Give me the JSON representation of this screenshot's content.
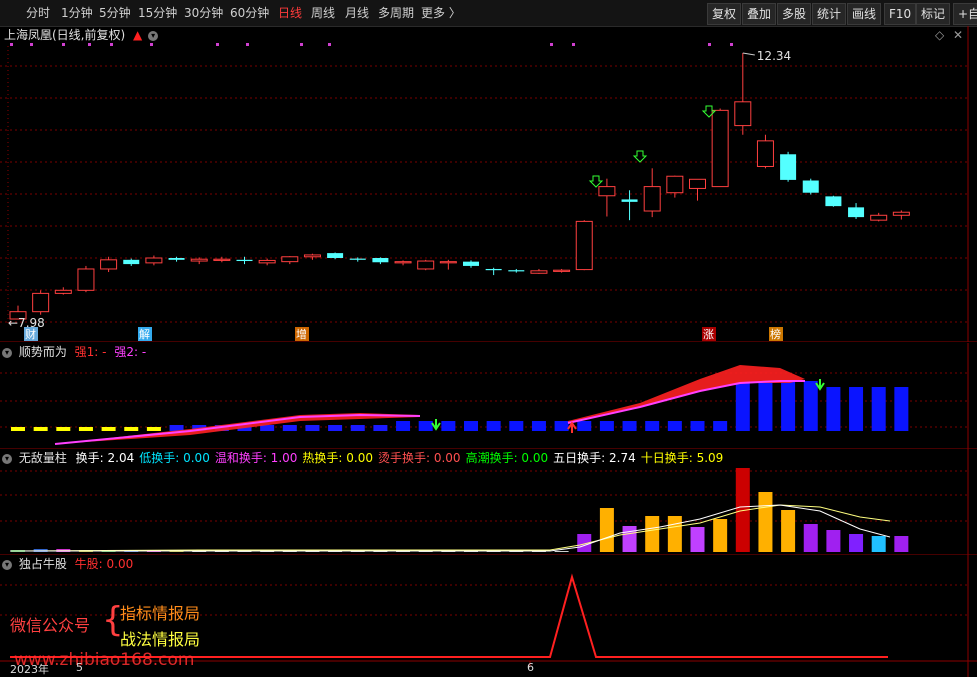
{
  "toolbar": {
    "periods": [
      "分时",
      "1分钟",
      "5分钟",
      "15分钟",
      "30分钟",
      "60分钟",
      "日线",
      "周线",
      "月线",
      "多周期",
      "更多 〉"
    ],
    "active_period": "日线",
    "buttons": [
      "复权",
      "叠加",
      "多股",
      "统计",
      "画线",
      "F10",
      "标记",
      "+自选"
    ]
  },
  "main_panel": {
    "title": "上海凤凰(日线,前复权)",
    "high_label": "12.34",
    "low_label": "7.98",
    "event_tags": [
      "财",
      "解",
      "增",
      "涨",
      "榜"
    ]
  },
  "indicator1": {
    "name": "顺势而为",
    "strong1_label": "强1: -",
    "strong2_label": "强2: -"
  },
  "indicator2": {
    "name": "无敌量柱",
    "items": [
      {
        "label": "换手: 2.04",
        "color": "#ffffff"
      },
      {
        "label": "低换手: 0.00",
        "color": "#00e5ff"
      },
      {
        "label": "温和换手: 1.00",
        "color": "#ff40ff"
      },
      {
        "label": "热换手: 0.00",
        "color": "#ffff00"
      },
      {
        "label": "烫手换手: 0.00",
        "color": "#ff5050"
      },
      {
        "label": "高潮换手: 0.00",
        "color": "#00ff00"
      },
      {
        "label": "五日换手: 2.74",
        "color": "#ffffff"
      },
      {
        "label": "十日换手: 5.09",
        "color": "#ffff00"
      }
    ]
  },
  "indicator3": {
    "name": "独占牛股",
    "value_label": "牛股: 0.00"
  },
  "watermark": {
    "line_prefix": "微信公众号",
    "brace": "{",
    "line1": "指标情报局",
    "line2": "战法情报局",
    "url": "www.zhibiao168.com"
  },
  "date_axis": {
    "year": "2023年",
    "mark1": "5",
    "mark2": "6"
  },
  "colors": {
    "up": "#ff4040",
    "down": "#54ffff",
    "grid": "#8b0000",
    "active": "#ff3b3b"
  },
  "candles": [
    {
      "o": 7.98,
      "h": 8.2,
      "l": 7.98,
      "c": 8.1
    },
    {
      "o": 8.1,
      "h": 8.45,
      "l": 8.05,
      "c": 8.4
    },
    {
      "o": 8.4,
      "h": 8.5,
      "l": 8.38,
      "c": 8.45
    },
    {
      "o": 8.45,
      "h": 8.85,
      "l": 8.42,
      "c": 8.8
    },
    {
      "o": 8.8,
      "h": 9.0,
      "l": 8.75,
      "c": 8.95
    },
    {
      "o": 8.95,
      "h": 8.97,
      "l": 8.85,
      "c": 8.88
    },
    {
      "o": 8.9,
      "h": 9.02,
      "l": 8.86,
      "c": 8.98
    },
    {
      "o": 8.98,
      "h": 9.0,
      "l": 8.92,
      "c": 8.95
    },
    {
      "o": 8.93,
      "h": 8.99,
      "l": 8.88,
      "c": 8.96
    },
    {
      "o": 8.94,
      "h": 9.0,
      "l": 8.91,
      "c": 8.96
    },
    {
      "o": 8.95,
      "h": 9.0,
      "l": 8.88,
      "c": 8.94
    },
    {
      "o": 8.9,
      "h": 8.97,
      "l": 8.86,
      "c": 8.94
    },
    {
      "o": 8.92,
      "h": 9.01,
      "l": 8.88,
      "c": 9.0
    },
    {
      "o": 9.0,
      "h": 9.05,
      "l": 8.95,
      "c": 9.03
    },
    {
      "o": 9.06,
      "h": 9.07,
      "l": 8.96,
      "c": 8.98
    },
    {
      "o": 8.97,
      "h": 8.99,
      "l": 8.92,
      "c": 8.96
    },
    {
      "o": 8.98,
      "h": 8.99,
      "l": 8.88,
      "c": 8.91
    },
    {
      "o": 8.9,
      "h": 8.94,
      "l": 8.86,
      "c": 8.92
    },
    {
      "o": 8.8,
      "h": 8.95,
      "l": 8.78,
      "c": 8.93
    },
    {
      "o": 8.92,
      "h": 8.95,
      "l": 8.79,
      "c": 8.92
    },
    {
      "o": 8.92,
      "h": 8.94,
      "l": 8.82,
      "c": 8.85
    },
    {
      "o": 8.8,
      "h": 8.82,
      "l": 8.7,
      "c": 8.79
    },
    {
      "o": 8.78,
      "h": 8.8,
      "l": 8.74,
      "c": 8.77
    },
    {
      "o": 8.73,
      "h": 8.8,
      "l": 8.72,
      "c": 8.77
    },
    {
      "o": 8.76,
      "h": 8.8,
      "l": 8.74,
      "c": 8.78
    },
    {
      "o": 8.79,
      "h": 9.6,
      "l": 8.78,
      "c": 9.58
    },
    {
      "o": 10.0,
      "h": 10.28,
      "l": 9.66,
      "c": 10.15
    },
    {
      "o": 9.94,
      "h": 10.09,
      "l": 9.6,
      "c": 9.9
    },
    {
      "o": 9.75,
      "h": 10.45,
      "l": 9.65,
      "c": 10.15
    },
    {
      "o": 10.05,
      "h": 10.33,
      "l": 9.97,
      "c": 10.32
    },
    {
      "o": 10.12,
      "h": 10.26,
      "l": 9.92,
      "c": 10.27
    },
    {
      "o": 10.15,
      "h": 11.43,
      "l": 10.15,
      "c": 11.4
    },
    {
      "o": 11.15,
      "h": 12.34,
      "l": 11.0,
      "c": 11.54
    },
    {
      "o": 10.48,
      "h": 11.0,
      "l": 10.45,
      "c": 10.9
    },
    {
      "o": 10.68,
      "h": 10.72,
      "l": 10.23,
      "c": 10.26
    },
    {
      "o": 10.25,
      "h": 10.28,
      "l": 10.02,
      "c": 10.05
    },
    {
      "o": 9.99,
      "h": 10.0,
      "l": 9.82,
      "c": 9.83
    },
    {
      "o": 9.81,
      "h": 9.88,
      "l": 9.62,
      "c": 9.65
    },
    {
      "o": 9.6,
      "h": 9.72,
      "l": 9.58,
      "c": 9.68
    },
    {
      "o": 9.68,
      "h": 9.76,
      "l": 9.61,
      "c": 9.73
    }
  ]
}
